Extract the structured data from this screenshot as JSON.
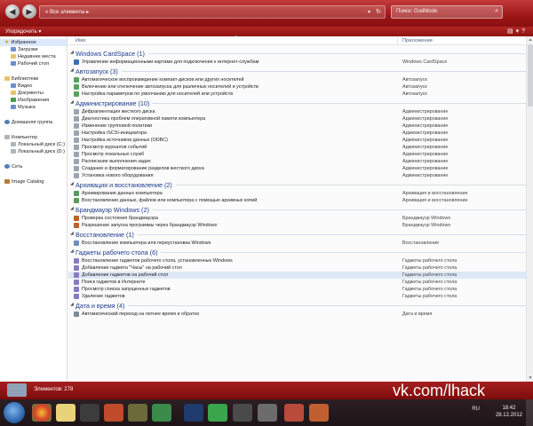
{
  "titlebar": {
    "breadcrumb": "« Все элементы ▸",
    "search_placeholder": "Поиск: GodMode"
  },
  "toolbar": {
    "organize_label": "Упорядочить ▾"
  },
  "sidebar": {
    "favorites": {
      "label": "Избранное",
      "items": [
        "Загрузки",
        "Недавние места",
        "Рабочий стол"
      ]
    },
    "libraries": {
      "label": "Библиотеки",
      "items": [
        "Видео",
        "Документы",
        "Изображения",
        "Музыка"
      ]
    },
    "homegroup": "Домашняя группа",
    "computer": {
      "label": "Компьютер",
      "items": [
        "Локальный диск (C:)",
        "Локальный диск (D:)"
      ]
    },
    "network": "Сеть",
    "image_catalog": "Image Catalog"
  },
  "columns": {
    "name": "Имя",
    "app": "Приложение"
  },
  "groups": [
    {
      "name": "Windows CardSpace (1)",
      "icon": "card-icon",
      "rows": [
        {
          "name": "Управление информационными картами для подключения к интернет-службам",
          "app": "Windows CardSpace"
        }
      ]
    },
    {
      "name": "Автозапуск (3)",
      "icon": "autoplay-icon",
      "rows": [
        {
          "name": "Автоматическое воспроизведение компакт-дисков или других носителей",
          "app": "Автозапуск"
        },
        {
          "name": "Включение или отключение автозапуска для различных носителей и устройств",
          "app": "Автозапуск"
        },
        {
          "name": "Настройка параметров по умолчанию для носителей или устройств",
          "app": "Автозапуск"
        }
      ]
    },
    {
      "name": "Администрирование (10)",
      "icon": "admin-icon",
      "rows": [
        {
          "name": "Дефрагментация жесткого диска",
          "app": "Администрирование"
        },
        {
          "name": "Диагностика проблем оперативной памяти компьютера",
          "app": "Администрирование"
        },
        {
          "name": "Изменение групповой политики",
          "app": "Администрирование"
        },
        {
          "name": "Настройка iSCSI-инициатора",
          "app": "Администрирование"
        },
        {
          "name": "Настройка источников данных (ODBC)",
          "app": "Администрирование"
        },
        {
          "name": "Просмотр журналов событий",
          "app": "Администрирование"
        },
        {
          "name": "Просмотр локальных служб",
          "app": "Администрирование"
        },
        {
          "name": "Расписание выполнения задач",
          "app": "Администрирование"
        },
        {
          "name": "Создание и форматирование разделов жесткого диска",
          "app": "Администрирование"
        },
        {
          "name": "Установка нового оборудования",
          "app": "Администрирование"
        }
      ]
    },
    {
      "name": "Архивация и восстановление (2)",
      "icon": "backup-icon",
      "rows": [
        {
          "name": "Архивирование данных компьютера",
          "app": "Архивация и восстановление"
        },
        {
          "name": "Восстановление данных, файлов или компьютера с помощью архивных копий",
          "app": "Архивация и восстановление"
        }
      ]
    },
    {
      "name": "Брандмауэр Windows (2)",
      "icon": "firewall-icon",
      "rows": [
        {
          "name": "Проверка состояния брандмауэра",
          "app": "Брандмауэр Windows"
        },
        {
          "name": "Разрешение запуска программы через брандмауэр Windows",
          "app": "Брандмауэр Windows"
        }
      ]
    },
    {
      "name": "Восстановление (1)",
      "icon": "restore-icon",
      "rows": [
        {
          "name": "Восстановление компьютера или переустановка Windows",
          "app": "Восстановление"
        }
      ]
    },
    {
      "name": "Гаджеты рабочего стола (6)",
      "icon": "gadget-icon",
      "rows": [
        {
          "name": "Восстановление гаджетов рабочего стола, установленных Windows",
          "app": "Гаджеты рабочего стола"
        },
        {
          "name": "Добавление гаджета \"Часы\" на рабочий стол",
          "app": "Гаджеты рабочего стола"
        },
        {
          "name": "Добавление гаджетов на рабочий стол",
          "app": "Гаджеты рабочего стола",
          "highlight": true
        },
        {
          "name": "Поиск гаджетов в Интернете",
          "app": "Гаджеты рабочего стола"
        },
        {
          "name": "Просмотр списка запущенных гаджетов",
          "app": "Гаджеты рабочего стола"
        },
        {
          "name": "Удаление гаджетов",
          "app": "Гаджеты рабочего стола"
        }
      ]
    },
    {
      "name": "Дата и время (4)",
      "icon": "clock-icon",
      "rows": [
        {
          "name": "Автоматический переход на летнее время и обратно",
          "app": "Дата и время"
        }
      ]
    }
  ],
  "status": {
    "count": "Элементов: 278",
    "watermark": "vk.com/lhack"
  },
  "taskbar": {
    "lang": "RU",
    "time": "18:42",
    "date": "28.12.2012"
  }
}
